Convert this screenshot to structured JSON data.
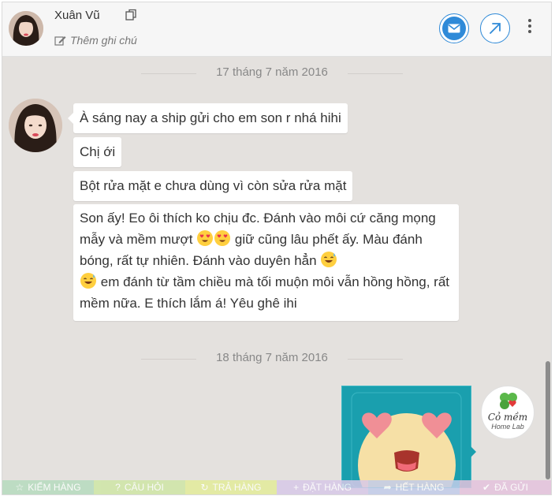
{
  "header": {
    "name": "Xuân Vũ",
    "note_label": "Thêm ghi chú"
  },
  "dates": [
    "17 tháng 7 năm 2016",
    "18 tháng 7 năm 2016"
  ],
  "messages": [
    "À sáng nay a ship gửi cho em son r nhá hihi",
    "Chị ới",
    "Bột rửa mặt e chưa dùng vì còn sửa rửa mặt"
  ],
  "long_message": {
    "part1": "Son ấy! Eo ôi thích ko chịu đc. Đánh vào môi cứ căng mọng mẫy và mềm mượt",
    "part2": "giữ cũng lâu phết ấy. Màu đánh bóng, rất tự nhiên. Đánh vào duyên hẳn",
    "part3": "em đánh từ tầm chiều mà tối muộn môi vẫn hồng hồng, rất mềm nữa. E thích lắm á! Yêu ghê ihi"
  },
  "brand": {
    "name": "Cỏ mềm",
    "subtitle": "Home Lab"
  },
  "tags": [
    {
      "icon": "star-icon",
      "label": "KIỂM HÀNG",
      "color": "#b7dcbf"
    },
    {
      "icon": "question-icon",
      "label": "CÂU HỎI",
      "color": "#cfe6a6"
    },
    {
      "icon": "refresh-icon",
      "label": "TRẢ HÀNG",
      "color": "#e3ec9b"
    },
    {
      "icon": "plus-icon",
      "label": "ĐẶT HÀNG",
      "color": "#d8c9e8"
    },
    {
      "icon": "share-icon",
      "label": "HẾT HÀNG",
      "color": "#c2cdea"
    },
    {
      "icon": "check-icon",
      "label": "ĐÃ GỬI",
      "color": "#e5c3dd"
    }
  ],
  "colors": {
    "accent": "#2f8ad8",
    "chat_bg": "#e4e1de",
    "sticker_bg": "#1a9fae"
  }
}
